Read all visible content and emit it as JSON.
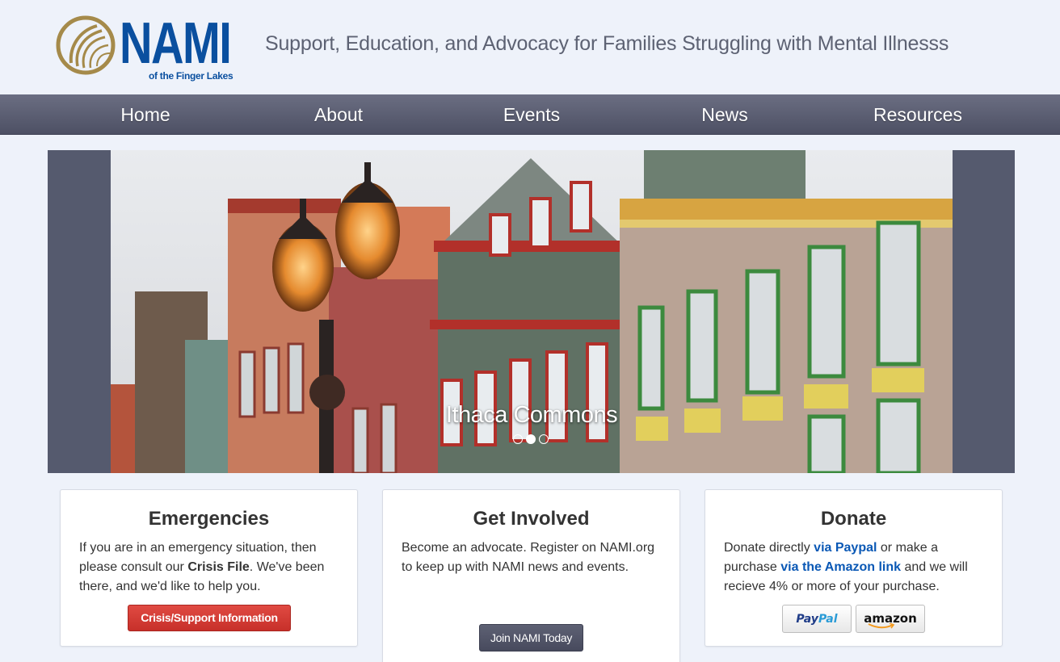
{
  "brand": {
    "logo_word": "NAMI",
    "logo_sub": "of the Finger Lakes",
    "tagline": "Support, Education, and Advocacy for Families Struggling with Mental Illnesss",
    "primary_color": "#0a4f9f",
    "accent_color": "#a58a4a"
  },
  "nav": {
    "items": [
      {
        "label": "Home"
      },
      {
        "label": "About"
      },
      {
        "label": "Events"
      },
      {
        "label": "News"
      },
      {
        "label": "Resources"
      }
    ]
  },
  "carousel": {
    "caption": "Ithaca Commons",
    "slide_count": 3,
    "active_index": 1
  },
  "cards": {
    "emergencies": {
      "title": "Emergencies",
      "text_1": "If you are in an emergency situation, then please consult our ",
      "text_bold": "Crisis File",
      "text_2": ". We've been there, and we'd like to help you.",
      "button": "Crisis/Support Information"
    },
    "get_involved": {
      "title": "Get Involved",
      "text": "Become an advocate. Register on NAMI.org to keep up with NAMI news and events.",
      "button": "Join NAMI Today"
    },
    "donate": {
      "title": "Donate",
      "text_1": "Donate directly ",
      "link_paypal": "via Paypal",
      "text_2": " or make a purchase ",
      "link_amazon": "via the Amazon link",
      "text_3": " and we will recieve 4% or more of your purchase.",
      "paypal_label_a": "Pay",
      "paypal_label_b": "Pal",
      "amazon_label": "amazon"
    }
  }
}
